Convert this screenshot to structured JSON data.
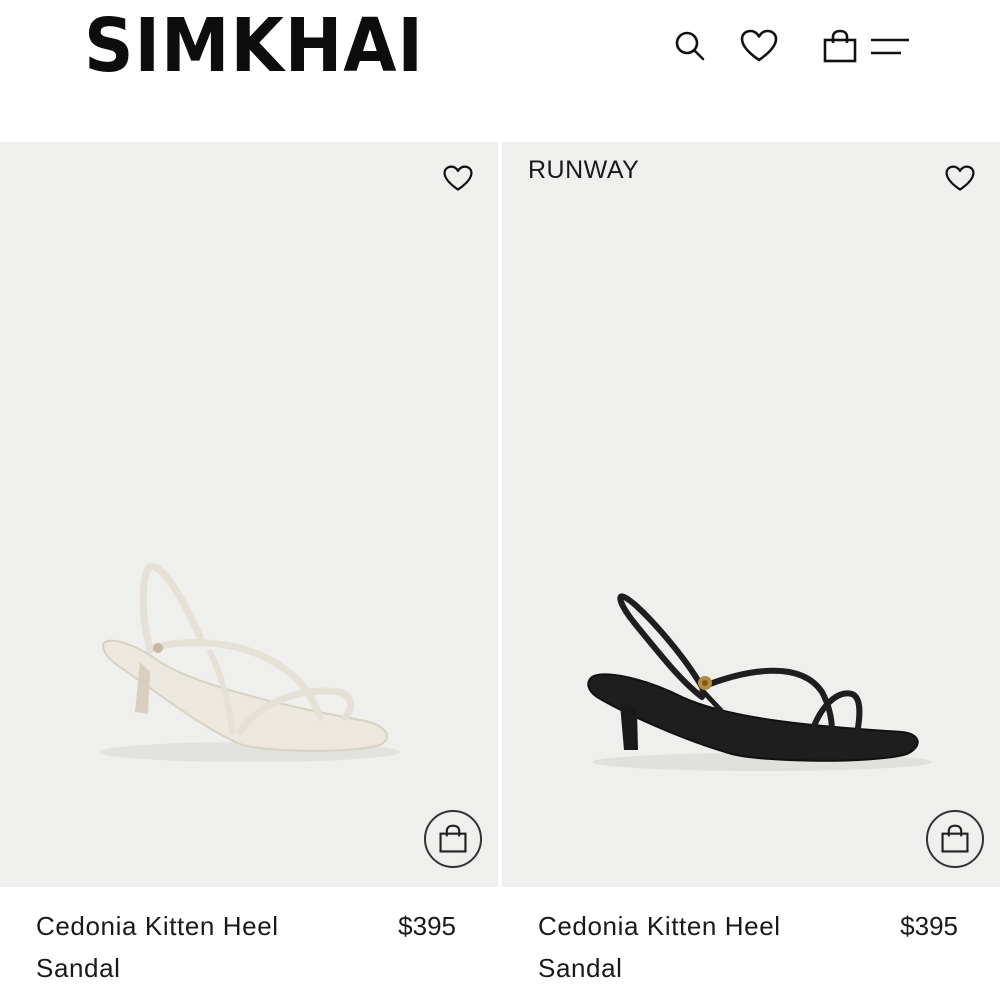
{
  "brand": {
    "name": "SIMKHAI"
  },
  "header": {
    "icons": [
      "search-icon",
      "heart-icon",
      "shopping-bag-icon",
      "menu-icon"
    ]
  },
  "products": [
    {
      "badge": "",
      "name": "Cedonia Kitten Heel Sandal",
      "price": "$395",
      "color": "#e8e4da"
    },
    {
      "badge": "RUNWAY",
      "name": "Cedonia Kitten Heel Sandal",
      "price": "$395",
      "color": "#1c1c1c"
    }
  ]
}
